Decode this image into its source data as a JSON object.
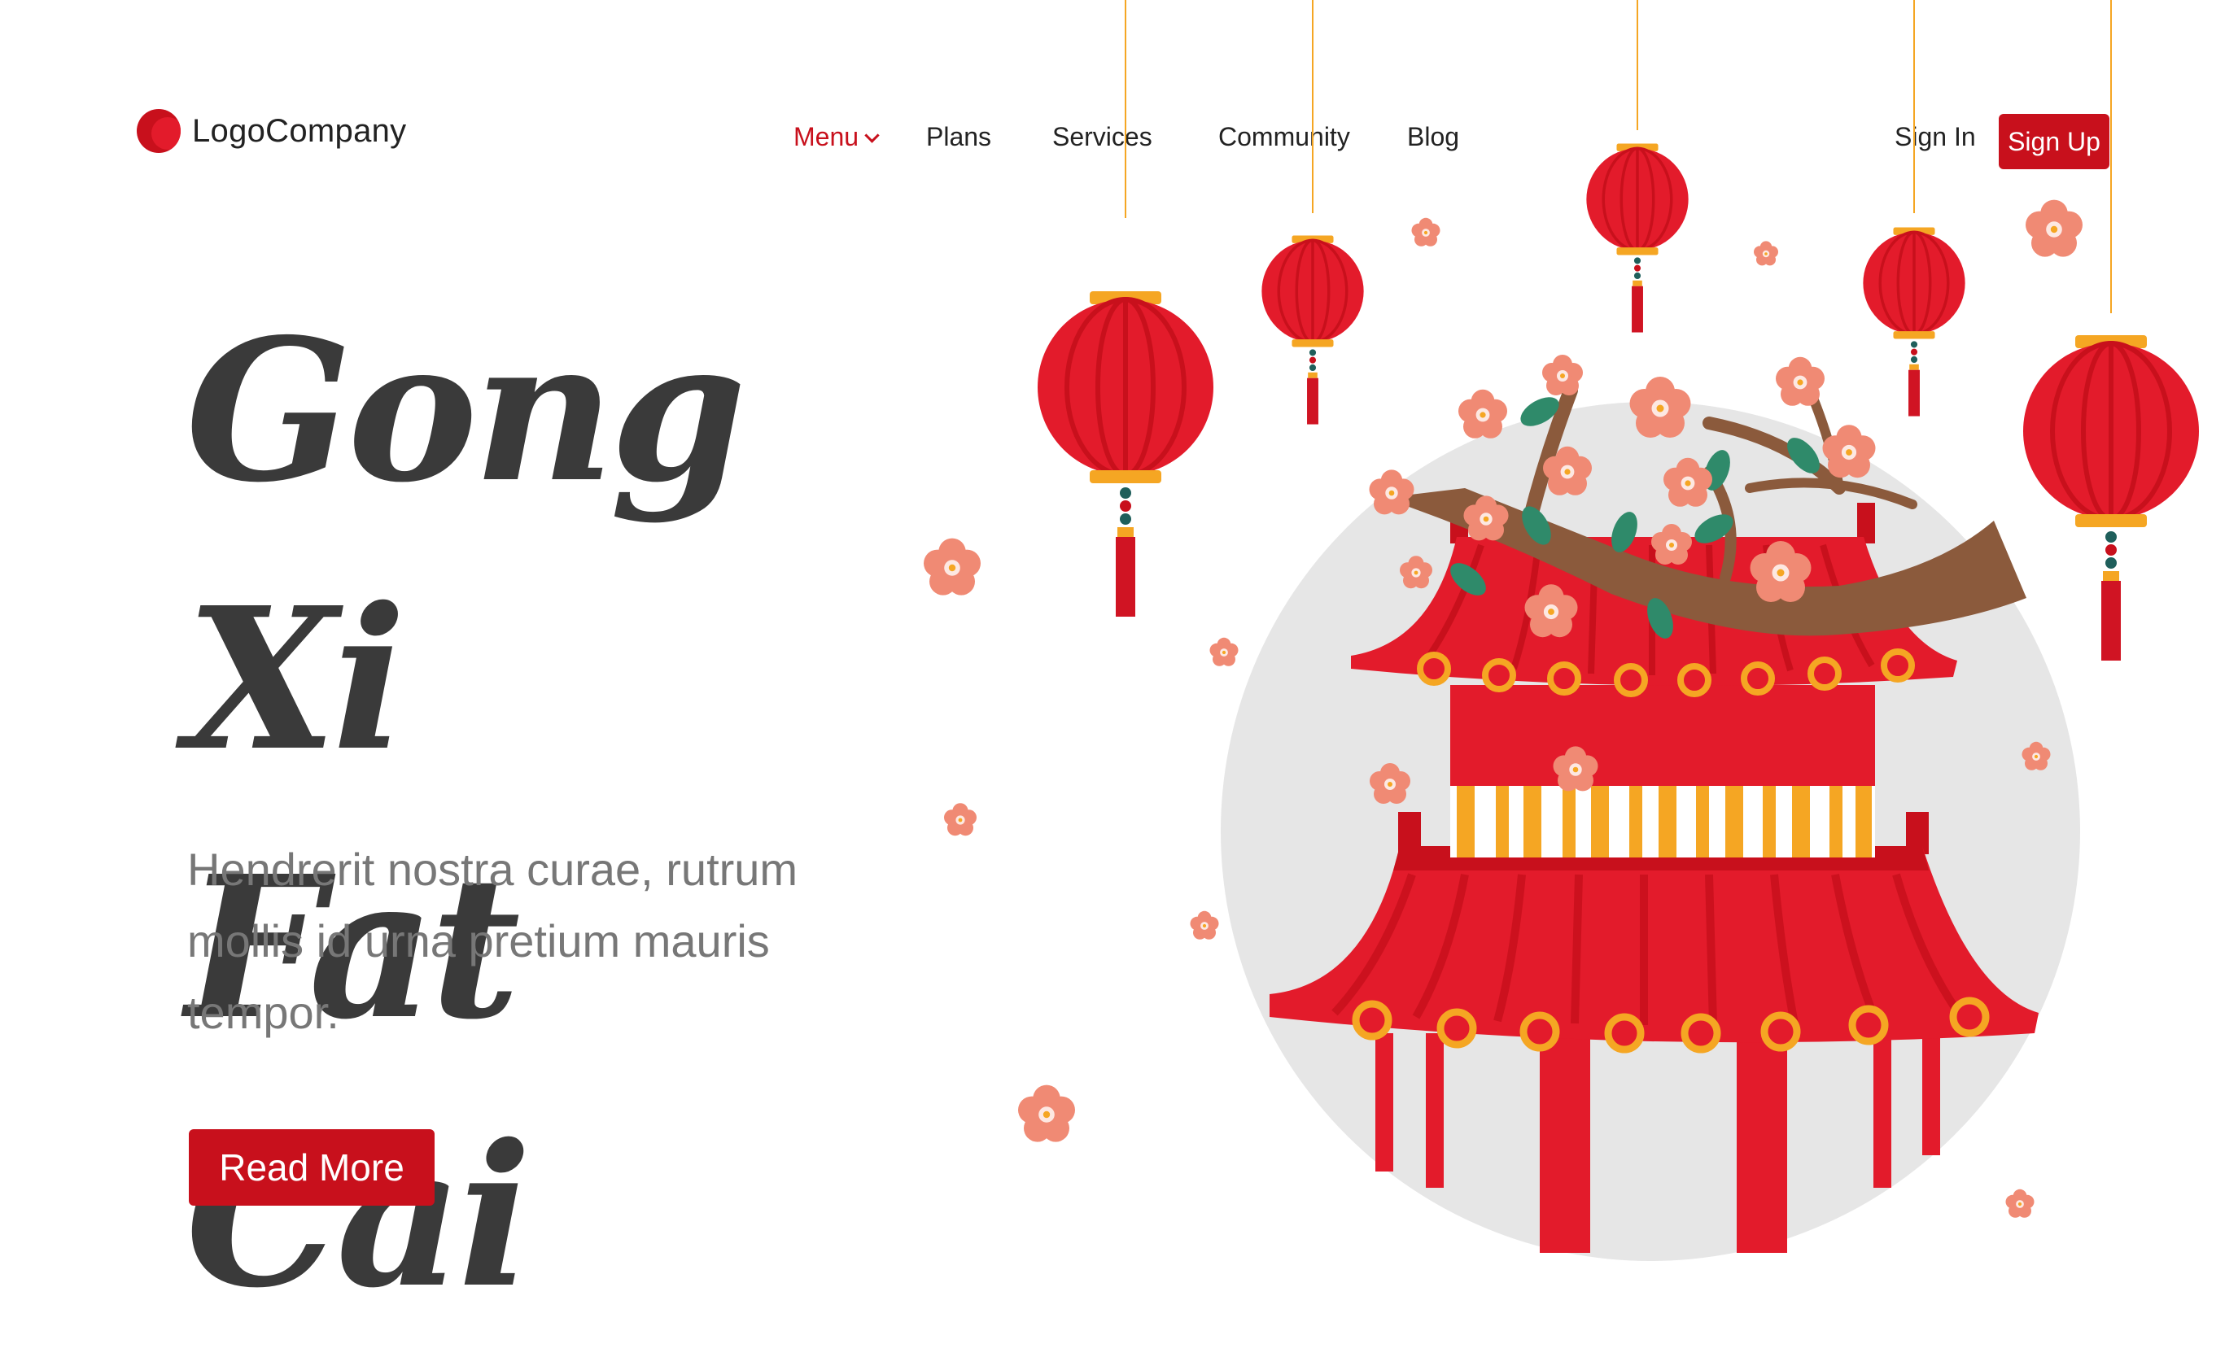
{
  "brand": {
    "name": "LogoCompany",
    "accent": "#c8101c"
  },
  "nav": {
    "items": [
      {
        "label": "Menu",
        "active": true
      },
      {
        "label": "Plans"
      },
      {
        "label": "Services"
      },
      {
        "label": "Community"
      },
      {
        "label": "Blog"
      }
    ]
  },
  "auth": {
    "sign_in": "Sign In",
    "sign_up": "Sign Up"
  },
  "hero": {
    "title_line1": "Gong Xi",
    "title_line2": "Fat Cai",
    "subtitle": "Hendrerit nostra curae, rutrum mollis id urna pretium mauris tempor.",
    "cta": "Read More"
  },
  "icons": [
    "logo-mark-icon",
    "chevron-down-icon",
    "lantern-icon",
    "blossom-icon",
    "pagoda-illustration"
  ]
}
